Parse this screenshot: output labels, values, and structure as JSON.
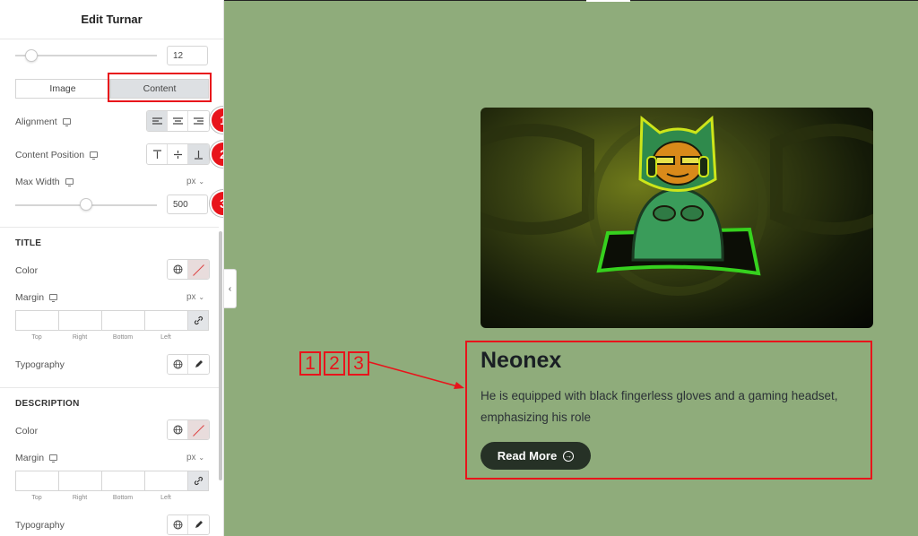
{
  "panel": {
    "title": "Edit Turnar",
    "top_slider_value": "12",
    "tabs": [
      {
        "label": "Image",
        "active": false
      },
      {
        "label": "Content",
        "active": true
      }
    ],
    "alignment_label": "Alignment",
    "content_position_label": "Content Position",
    "max_width": {
      "label": "Max Width",
      "unit": "px",
      "value": "500"
    },
    "title_section": {
      "heading": "TITLE",
      "color_label": "Color",
      "margin_label": "Margin",
      "margin_unit": "px",
      "margin_sides": [
        "Top",
        "Right",
        "Bottom",
        "Left"
      ],
      "typography_label": "Typography"
    },
    "description_section": {
      "heading": "DESCRIPTION",
      "color_label": "Color",
      "margin_label": "Margin",
      "margin_unit": "px",
      "margin_sides": [
        "Top",
        "Right",
        "Bottom",
        "Left"
      ],
      "typography_label": "Typography"
    }
  },
  "annotations": {
    "badges": [
      "1",
      "2",
      "3"
    ],
    "tags": [
      "1",
      "2",
      "3"
    ],
    "highlight_color": "#e8141b"
  },
  "preview": {
    "background_color": "#8fac7b",
    "image_icon": "gamer-mascot-image",
    "card_title": "Neonex",
    "card_description": "He is equipped with black fingerless gloves and a gaming headset, emphasizing his role",
    "button_label": "Read More",
    "button_icon": "arrow-circle-right-icon"
  }
}
